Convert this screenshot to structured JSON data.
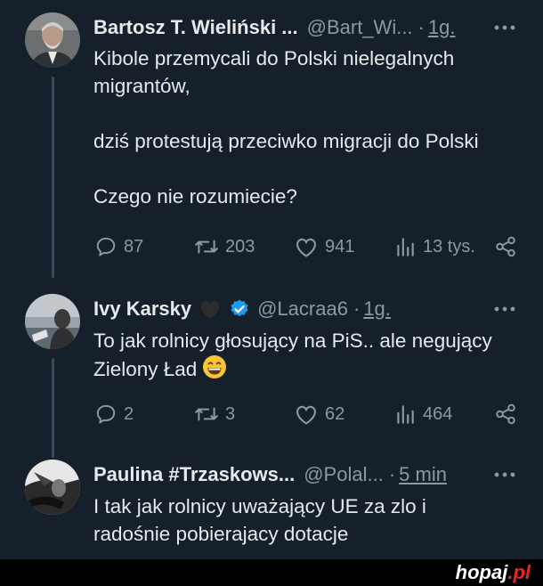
{
  "tweets": [
    {
      "name": "Bartosz T. Wieliński ...",
      "handle": "@Bart_Wi...",
      "time": "1g.",
      "text": "Kibole przemycali do Polski nielegalnych migrantów,\n\ndziś protestują przeciwko migracji do Polski\n\nCzego nie rozumiecie?",
      "replies": "87",
      "retweets": "203",
      "likes": "941",
      "views": "13 tys."
    },
    {
      "name": "Ivy Karsky",
      "handle": "@Lacraa6",
      "time": "1g.",
      "text": "To jak rolnicy głosujący na PiS.. ale negujący Zielony Ład",
      "replies": "2",
      "retweets": "3",
      "likes": "62",
      "views": "464"
    },
    {
      "name": "Paulina #Trzaskows...",
      "handle": "@Polal...",
      "time": "5 min",
      "text": "I tak jak rolnicy uważający UE za zlo i radośnie pobierajacy dotacje"
    }
  ],
  "icons": {
    "more": "more-icon",
    "reply": "reply-icon",
    "retweet": "retweet-icon",
    "like": "heart-icon",
    "views": "views-icon",
    "share": "share-icon",
    "verified": "verified-badge-icon",
    "heart_black": "black-heart-icon",
    "grin": "grinning-emoji-icon"
  },
  "colors": {
    "background": "#15202b",
    "text": "#e7e9ea",
    "muted": "#8b98a5",
    "verified": "#1d9bf0",
    "logo_accent": "#e8232a"
  },
  "watermark": {
    "logo": "hopaj.pl"
  }
}
